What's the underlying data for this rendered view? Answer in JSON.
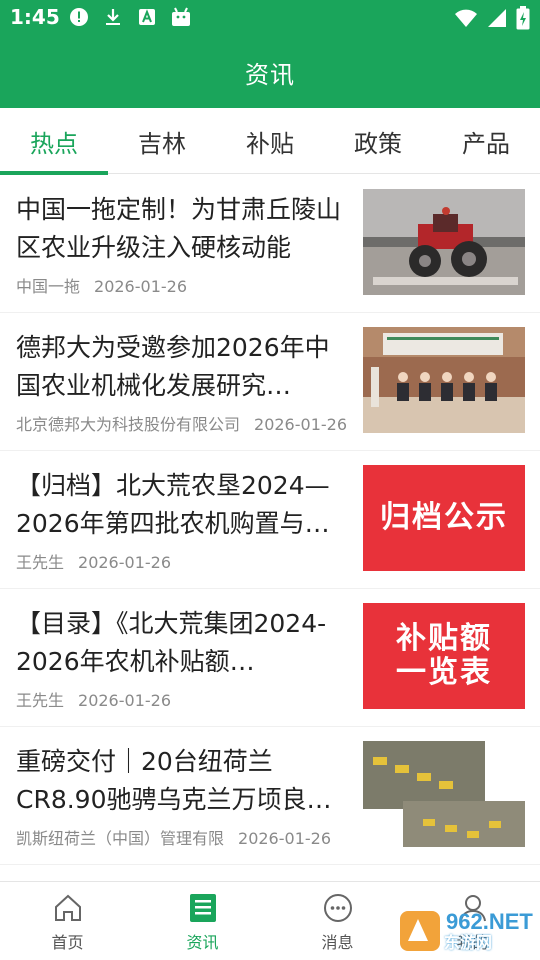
{
  "status_bar": {
    "time": "1:45",
    "left_icons": [
      "alert-icon",
      "download-icon",
      "a-icon",
      "android-icon"
    ],
    "right_icons": [
      "wifi-icon",
      "signal-icon",
      "battery-icon"
    ]
  },
  "header": {
    "title": "资讯"
  },
  "tabs": [
    {
      "label": "热点",
      "active": true
    },
    {
      "label": "吉林",
      "active": false
    },
    {
      "label": "补贴",
      "active": false
    },
    {
      "label": "政策",
      "active": false
    },
    {
      "label": "产品",
      "active": false
    }
  ],
  "news": [
    {
      "title": "中国一拖定制！为甘肃丘陵山区农业升级注入硬核动能",
      "source": "中国一拖",
      "date": "2026-01-26",
      "thumb": "tractor-photo"
    },
    {
      "title": "德邦大为受邀参加2026年中国农业机械化发展研究…",
      "source": "北京德邦大为科技股份有限公司",
      "date": "2026-01-26",
      "thumb": "meeting-photo"
    },
    {
      "title": "【归档】北大荒农垦2024—2026年第四批农机购置与…",
      "source": "王先生",
      "date": "2026-01-26",
      "thumb": "red-banner",
      "thumb_text": [
        "归档公示"
      ]
    },
    {
      "title": "【目录】《北大荒集团2024-2026年农机补贴额…",
      "source": "王先生",
      "date": "2026-01-26",
      "thumb": "red-banner",
      "thumb_text": [
        "补贴额",
        "一览表"
      ]
    },
    {
      "title": "重磅交付｜20台纽荷兰CR8.90驰骋乌克兰万顷良…",
      "source": "凯斯纽荷兰（中国）管理有限",
      "date": "2026-01-26",
      "thumb": "harvester-photo"
    }
  ],
  "bottom_nav": [
    {
      "label": "首页",
      "icon": "home-icon",
      "active": false
    },
    {
      "label": "资讯",
      "icon": "news-icon",
      "active": true
    },
    {
      "label": "消息",
      "icon": "message-icon",
      "active": false
    },
    {
      "label": "我的",
      "icon": "user-icon",
      "active": false
    }
  ],
  "watermark": {
    "text": "东游网",
    "logo": "962.NET"
  },
  "colors": {
    "primary": "#1aa55b",
    "thumb_red": "#e8323a",
    "meta_gray": "#8a8a8a"
  }
}
